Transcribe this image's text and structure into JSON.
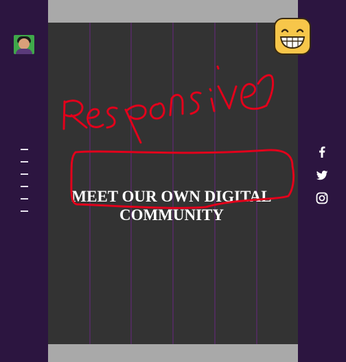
{
  "hero": {
    "title_line1": "MEET OUR OWN DIGITAL",
    "title_line2": "COMMUNITY"
  },
  "annotation": {
    "handwritten_text": "Responsive"
  },
  "nav": {
    "item_count": 6
  },
  "social": [
    {
      "icon": "facebook-icon"
    },
    {
      "icon": "twitter-icon"
    },
    {
      "icon": "instagram-icon"
    }
  ],
  "colors": {
    "sidebar": "#2c1540",
    "panel": "#333333",
    "frame": "#a9a9a9",
    "gridline": "#4e2d5a",
    "annotation_red": "#e3001b",
    "emoji_yellow": "#f7c64a"
  }
}
